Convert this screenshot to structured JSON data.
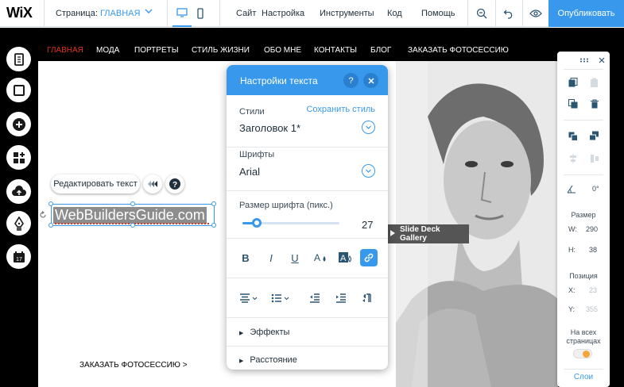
{
  "app": {
    "logo": "WiX"
  },
  "topbar": {
    "page_prefix": "Страница: ",
    "page_name": "ГЛАВНАЯ",
    "menu": [
      "Сайт",
      "Настройка",
      "Инструменты",
      "Код",
      "Помощь"
    ],
    "publish_label": "Опубликовать",
    "icons": [
      "desktop-icon",
      "mobile-icon",
      "zoom-icon",
      "undo-icon",
      "preview-icon"
    ]
  },
  "site_nav": {
    "items": [
      "ГЛАВНАЯ",
      "МОДА",
      "ПОРТРЕТЫ",
      "СТИЛЬ ЖИЗНИ",
      "ОБО МНЕ",
      "КОНТАКТЫ",
      "БЛОГ",
      "ЗАКАЗАТЬ ФОТОСЕССИЮ"
    ],
    "active_index": 0,
    "active_color": "#e2321f"
  },
  "left_toolbar": {
    "icons": [
      "pages-icon",
      "background-icon",
      "add-icon",
      "apps-icon",
      "upload-icon",
      "blog-icon",
      "bookings-icon"
    ]
  },
  "text_element": {
    "edit_label": "Редактировать текст",
    "text": "WebBuildersGuide.com",
    "help_glyph": "?"
  },
  "canvas": {
    "cta": "ЗАКАЗАТЬ ФОТОСЕССИЮ >",
    "slide_deck_label": "Slide Deck Gallery"
  },
  "text_panel": {
    "title": "Настройки текста",
    "help": "?",
    "styles_label": "Стили",
    "save_style_link": "Сохранить стиль",
    "style_value": "Заголовок 1*",
    "fonts_label": "Шрифты",
    "font_value": "Arial",
    "font_size_label": "Размер шрифта (пикс.)",
    "font_size_value": "27",
    "font_size_fraction": 0.15,
    "format_glyphs": {
      "bold": "B",
      "italic": "I",
      "underline": "U"
    },
    "effects_label": "Эффекты",
    "spacing_label": "Расстояние"
  },
  "inspector": {
    "rotation_value": "0°",
    "size_label": "Размер",
    "w_key": "W:",
    "w_value": "290",
    "h_key": "H:",
    "h_value": "38",
    "position_label": "Позиция",
    "x_key": "X:",
    "x_value": "23",
    "y_key": "Y:",
    "y_value": "355",
    "all_pages_label": "На всех страницах",
    "layers_label": "Слои"
  },
  "colors": {
    "accent": "#3899ec",
    "stage": "#000000",
    "toggle_knob": "#f7a43b"
  }
}
